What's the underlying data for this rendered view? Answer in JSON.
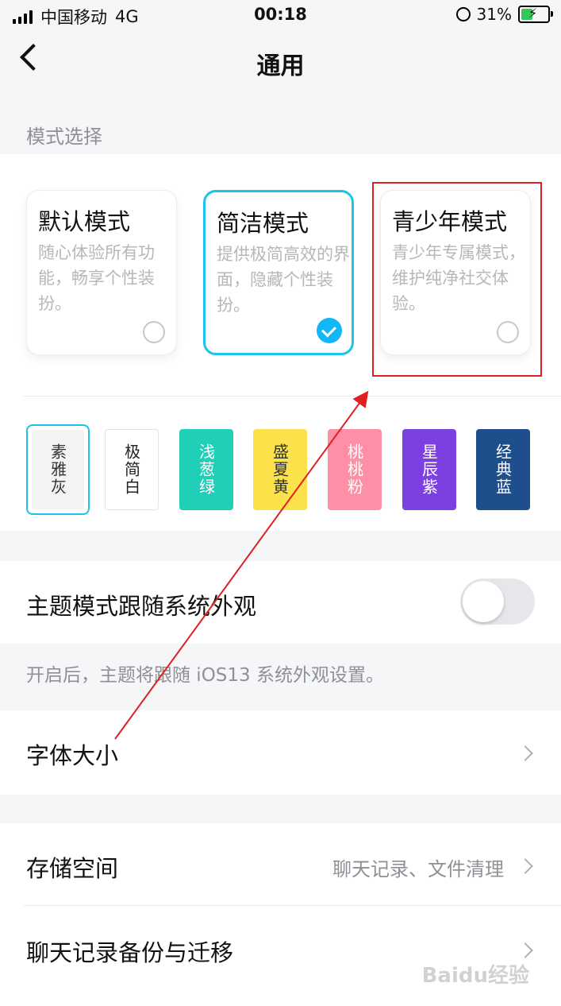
{
  "status_bar": {
    "carrier": "中国移动",
    "network": "4G",
    "time": "00:18",
    "battery": "31%"
  },
  "nav": {
    "title": "通用"
  },
  "mode_section": {
    "label": "模式选择"
  },
  "modes": [
    {
      "title": "默认模式",
      "desc": "随心体验所有功能，畅享个性装扮。",
      "selected": false
    },
    {
      "title": "简洁模式",
      "desc": "提供极简高效的界面，隐藏个性装扮。",
      "selected": true
    },
    {
      "title": "青少年模式",
      "desc": "青少年专属模式，维护纯净社交体验。",
      "selected": false
    }
  ],
  "themes": [
    {
      "label": "素雅灰",
      "color": "#f2f3f5",
      "text_color": "#333333",
      "selected": true
    },
    {
      "label": "极简白",
      "color": "#ffffff",
      "text_color": "#222222",
      "selected": false
    },
    {
      "label": "浅葱绿",
      "color": "#1fcfb8",
      "text_color": "#ffffff",
      "selected": false
    },
    {
      "label": "盛夏黄",
      "color": "#fce24a",
      "text_color": "#333333",
      "selected": false
    },
    {
      "label": "桃桃粉",
      "color": "#ff8fa6",
      "text_color": "#ffffff",
      "selected": false
    },
    {
      "label": "星辰紫",
      "color": "#7c3fe0",
      "text_color": "#ffffff",
      "selected": false
    },
    {
      "label": "经典蓝",
      "color": "#1f4e8c",
      "text_color": "#ffffff",
      "selected": false
    }
  ],
  "follow_system": {
    "label": "主题模式跟随系统外观",
    "enabled": false,
    "hint": "开启后，主题将跟随 iOS13 系统外观设置。"
  },
  "font_size": {
    "label": "字体大小"
  },
  "storage": {
    "label": "存储空间",
    "value": "聊天记录、文件清理"
  },
  "backup": {
    "label": "聊天记录备份与迁移"
  },
  "watermark": "Baidu经验",
  "colors": {
    "accent": "#1fc2e8",
    "check": "#12b7f5",
    "annotation": "#e02020"
  }
}
